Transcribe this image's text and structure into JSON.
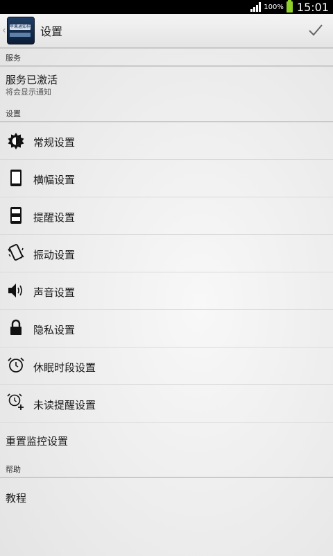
{
  "status_bar": {
    "battery": "100%",
    "time": "15:01"
  },
  "action_bar": {
    "app_icon_text": "苹果通知样式",
    "title": "设置"
  },
  "sections": {
    "service": {
      "header": "服务",
      "item_title": "服务已激活",
      "item_subtitle": "将会显示通知"
    },
    "settings": {
      "header": "设置",
      "items": [
        {
          "label": "常规设置",
          "icon": "brightness-gear-icon"
        },
        {
          "label": "横幅设置",
          "icon": "phone-icon"
        },
        {
          "label": "提醒设置",
          "icon": "phone-alert-icon"
        },
        {
          "label": "振动设置",
          "icon": "vibrate-icon"
        },
        {
          "label": "声音设置",
          "icon": "speaker-icon"
        },
        {
          "label": "隐私设置",
          "icon": "lock-icon"
        },
        {
          "label": "休眠时段设置",
          "icon": "alarm-clock-icon"
        },
        {
          "label": "未读提醒设置",
          "icon": "alarm-add-icon"
        }
      ],
      "reset_label": "重置监控设置"
    },
    "help": {
      "header": "帮助",
      "tutorial_label": "教程"
    }
  }
}
